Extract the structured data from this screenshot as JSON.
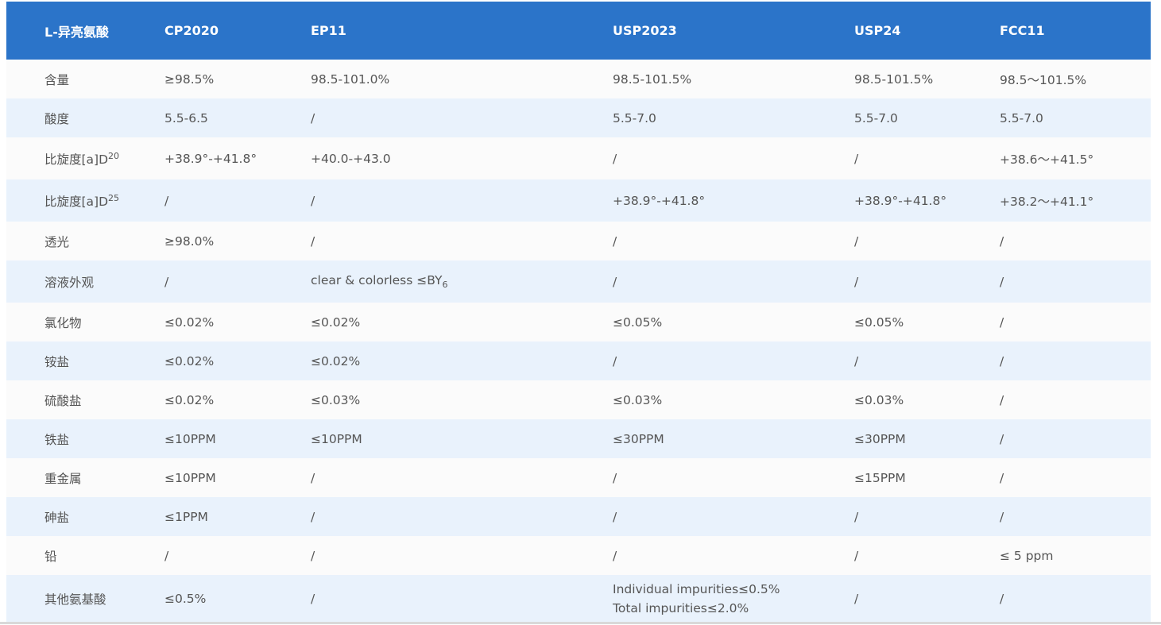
{
  "header": [
    "L-异亮氨酸",
    "CP2020",
    "EP11",
    "USP2023",
    "USP24",
    "FCC11"
  ],
  "rows": [
    {
      "label": "含量",
      "cells": [
        "≥98.5%",
        "98.5-101.0%",
        "98.5-101.5%",
        "98.5-101.5%",
        "98.5～101.5%"
      ]
    },
    {
      "label": "酸度",
      "cells": [
        "5.5-6.5",
        "/",
        "5.5-7.0",
        "5.5-7.0",
        "5.5-7.0"
      ]
    },
    {
      "label": "比旋度[a]D",
      "label_sup": "20",
      "cells": [
        "+38.9°-+41.8°",
        "+40.0-+43.0",
        "/",
        "/",
        "+38.6～+41.5°"
      ]
    },
    {
      "label": "比旋度[a]D",
      "label_sup": "25",
      "cells": [
        "/",
        "/",
        "+38.9°-+41.8°",
        "+38.9°-+41.8°",
        "+38.2～+41.1°"
      ]
    },
    {
      "label": "透光",
      "cells": [
        "≥98.0%",
        "/",
        "/",
        "/",
        "/"
      ]
    },
    {
      "label": "溶液外观",
      "cells": [
        "/",
        "clear & colorless ≤BY",
        "/",
        "/",
        "/"
      ],
      "ep_sub": "6"
    },
    {
      "label": "氯化物",
      "cells": [
        "≤0.02%",
        "≤0.02%",
        "≤0.05%",
        "≤0.05%",
        "/"
      ]
    },
    {
      "label": "铵盐",
      "cells": [
        "≤0.02%",
        "≤0.02%",
        "/",
        "/",
        "/"
      ]
    },
    {
      "label": "硫酸盐",
      "cells": [
        "≤0.02%",
        "≤0.03%",
        "≤0.03%",
        "≤0.03%",
        "/"
      ]
    },
    {
      "label": "铁盐",
      "cells": [
        "≤10PPM",
        "≤10PPM",
        "≤30PPM",
        "≤30PPM",
        "/"
      ]
    },
    {
      "label": "重金属",
      "cells": [
        "≤10PPM",
        "/",
        "/",
        "≤15PPM",
        "/"
      ]
    },
    {
      "label": "砷盐",
      "cells": [
        "≤1PPM",
        "/",
        "/",
        "/",
        "/"
      ]
    },
    {
      "label": "铅",
      "cells": [
        "/",
        "/",
        "/",
        "/",
        "≤ 5 ppm"
      ]
    },
    {
      "label": "其他氨基酸",
      "cells": [
        "≤0.5%",
        "/",
        "",
        "/",
        "/"
      ],
      "usp2023_lines": [
        "Individual impurities≤0.5%",
        "Total impurities≤2.0%"
      ]
    }
  ],
  "colors": {
    "header_bg": "#2b74c9",
    "row_alt_bg": "#e9f2fc",
    "row_bg": "#fbfbfb"
  }
}
